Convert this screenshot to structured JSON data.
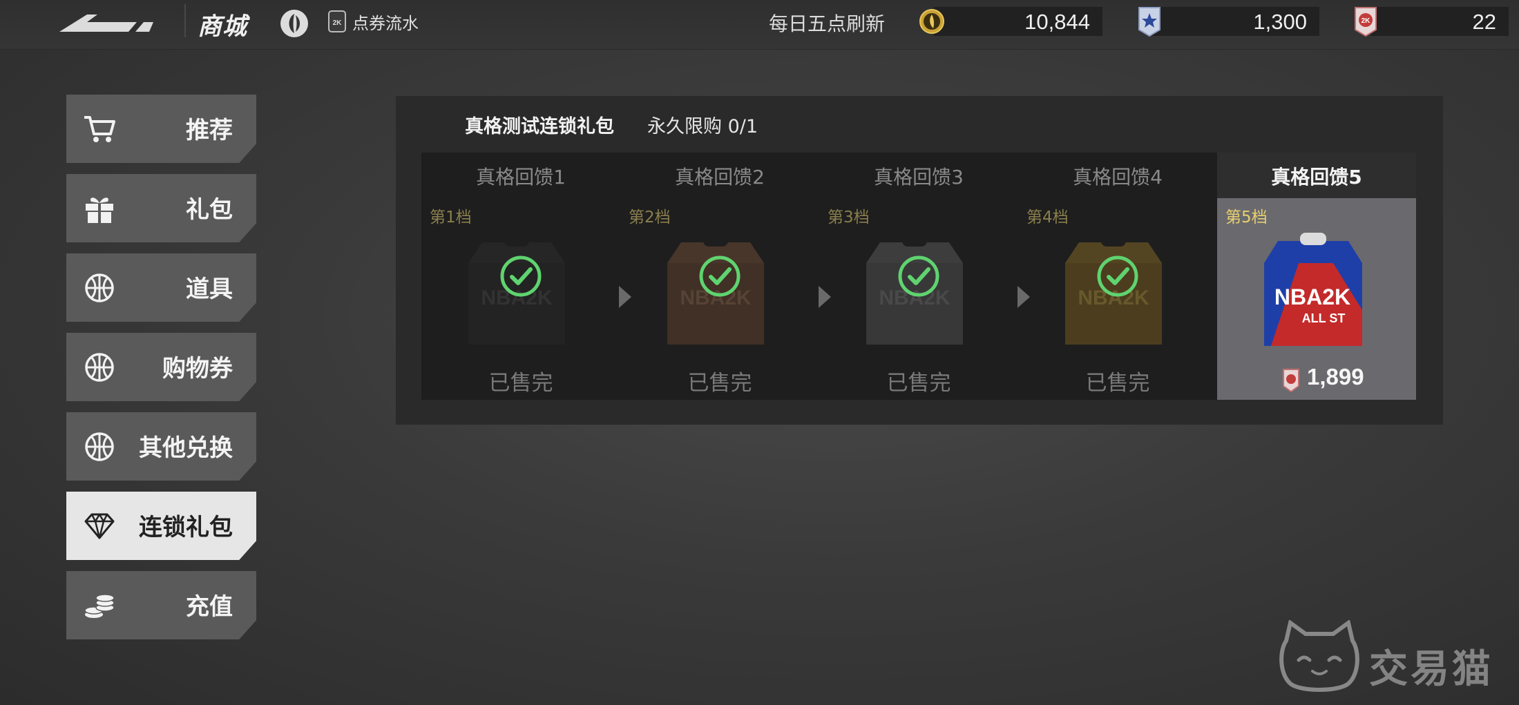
{
  "header": {
    "title": "商城",
    "flow_link": "点券流水",
    "refresh_note": "每日五点刷新",
    "currencies": [
      {
        "icon": "gold-coin-icon",
        "value": "10,844"
      },
      {
        "icon": "star-badge-icon",
        "value": "1,300"
      },
      {
        "icon": "2k-point-icon",
        "value": "22"
      }
    ]
  },
  "sidebar": {
    "items": [
      {
        "label": "推荐",
        "icon": "cart-icon"
      },
      {
        "label": "礼包",
        "icon": "gift-icon"
      },
      {
        "label": "道具",
        "icon": "basketball-icon"
      },
      {
        "label": "购物券",
        "icon": "basketball-icon"
      },
      {
        "label": "其他兑换",
        "icon": "basketball-icon"
      },
      {
        "label": "连锁礼包",
        "icon": "diamond-icon",
        "active": true
      },
      {
        "label": "充值",
        "icon": "coins-icon"
      }
    ]
  },
  "pack": {
    "title": "真格测试连锁礼包",
    "limit": "永久限购 0/1",
    "tiers": [
      {
        "name": "真格回馈1",
        "level": "第1档",
        "status": "已售完"
      },
      {
        "name": "真格回馈2",
        "level": "第2档",
        "status": "已售完"
      },
      {
        "name": "真格回馈3",
        "level": "第3档",
        "status": "已售完"
      },
      {
        "name": "真格回馈4",
        "level": "第4档",
        "status": "已售完"
      },
      {
        "name": "真格回馈5",
        "level": "第5档",
        "price": "1,899"
      }
    ]
  },
  "watermark": {
    "text": "交易猫"
  },
  "colors": {
    "accent_gold": "#e8d070",
    "check_green": "#5fd36f",
    "panel": "#2a2a2a",
    "active_tab": "#e6e6e6"
  }
}
